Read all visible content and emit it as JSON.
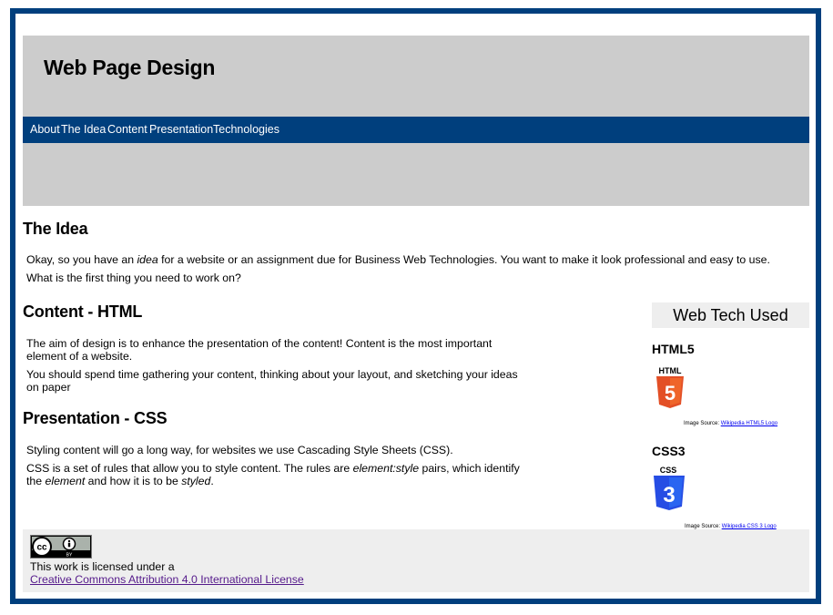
{
  "header": {
    "title": "Web Page Design"
  },
  "nav": {
    "items": [
      "About",
      "The Idea",
      "Content",
      "Presentation",
      "Technologies"
    ]
  },
  "idea": {
    "heading": "The Idea",
    "p1_a": "Okay, so you have an ",
    "p1_em": "idea",
    "p1_b": " for a website or an assignment due for Business Web Technologies. You want to make it look professional and easy to use.",
    "p2": "What is the first thing you need to work on?"
  },
  "content": {
    "heading": "Content - HTML",
    "p1": "The aim of design is to enhance the presentation of the content! Content is the most important element of a website.",
    "p2": "You should spend time gathering your content, thinking about your layout, and sketching your ideas on paper"
  },
  "presentation": {
    "heading": "Presentation - CSS",
    "p1": "Styling content will go a long way, for websites we use Cascading Style Sheets (CSS).",
    "p2_a": "CSS is a set of rules that allow you to style content. The rules are ",
    "p2_em1": "element:style",
    "p2_b": " pairs, which identify the ",
    "p2_em2": "element",
    "p2_c": " and how it is to be ",
    "p2_em3": "styled",
    "p2_d": "."
  },
  "sidebar": {
    "title": "Web Tech Used",
    "html5": {
      "heading": "HTML5",
      "logo_text": "HTML",
      "logo_number": "5",
      "source_label": "Image Source: ",
      "source_link": "Wikipedia HTML5 Logo",
      "color": "#e34f26"
    },
    "css3": {
      "heading": "CSS3",
      "logo_text": "CSS",
      "logo_number": "3",
      "source_label": "Image Source: ",
      "source_link": "Wikipedia CSS 3 Logo",
      "color": "#264de4"
    }
  },
  "footer": {
    "badge_icon": "cc-by-icon",
    "badge_cc": "cc",
    "badge_by": "BY",
    "text": "This work is licensed under a",
    "link": "Creative Commons Attribution 4.0 International License"
  }
}
